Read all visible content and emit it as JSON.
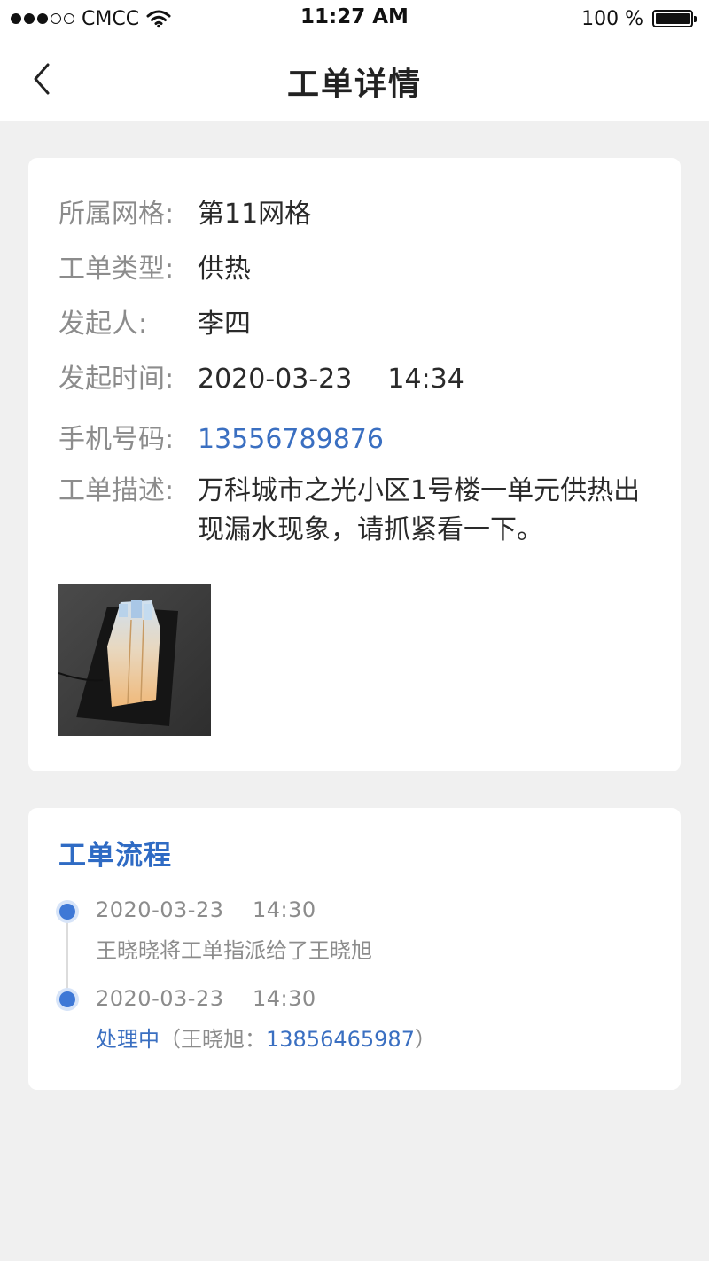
{
  "status_bar": {
    "carrier": "CMCC",
    "time": "11:27 AM",
    "battery": "100 %"
  },
  "nav": {
    "title": "工单详情",
    "back_icon": "chevron-left-icon"
  },
  "detail": {
    "grid_label": "所属网格:",
    "grid_value": "第11网格",
    "type_label": "工单类型:",
    "type_value": "供热",
    "initiator_label": "发起人:",
    "initiator_value": "李四",
    "time_label": "发起时间:",
    "time_date": "2020-03-23",
    "time_clock": "14:34",
    "phone_label": "手机号码:",
    "phone_value": "13556789876",
    "desc_label": "工单描述:",
    "desc_value": "万科城市之光小区1号楼一单元供热出现漏水现象，请抓紧看一下。"
  },
  "flow": {
    "title": "工单流程",
    "items": [
      {
        "date": "2020-03-23",
        "time": "14:30",
        "desc": "王晓晓将工单指派给了王晓旭"
      },
      {
        "date": "2020-03-23",
        "time": "14:30",
        "status": "处理中",
        "assignee_prefix": "（王晓旭：",
        "phone": "13856465987",
        "suffix": "）"
      }
    ]
  },
  "colors": {
    "accent": "#3a6fc1",
    "background": "#f0f0f0",
    "card": "#ffffff"
  }
}
